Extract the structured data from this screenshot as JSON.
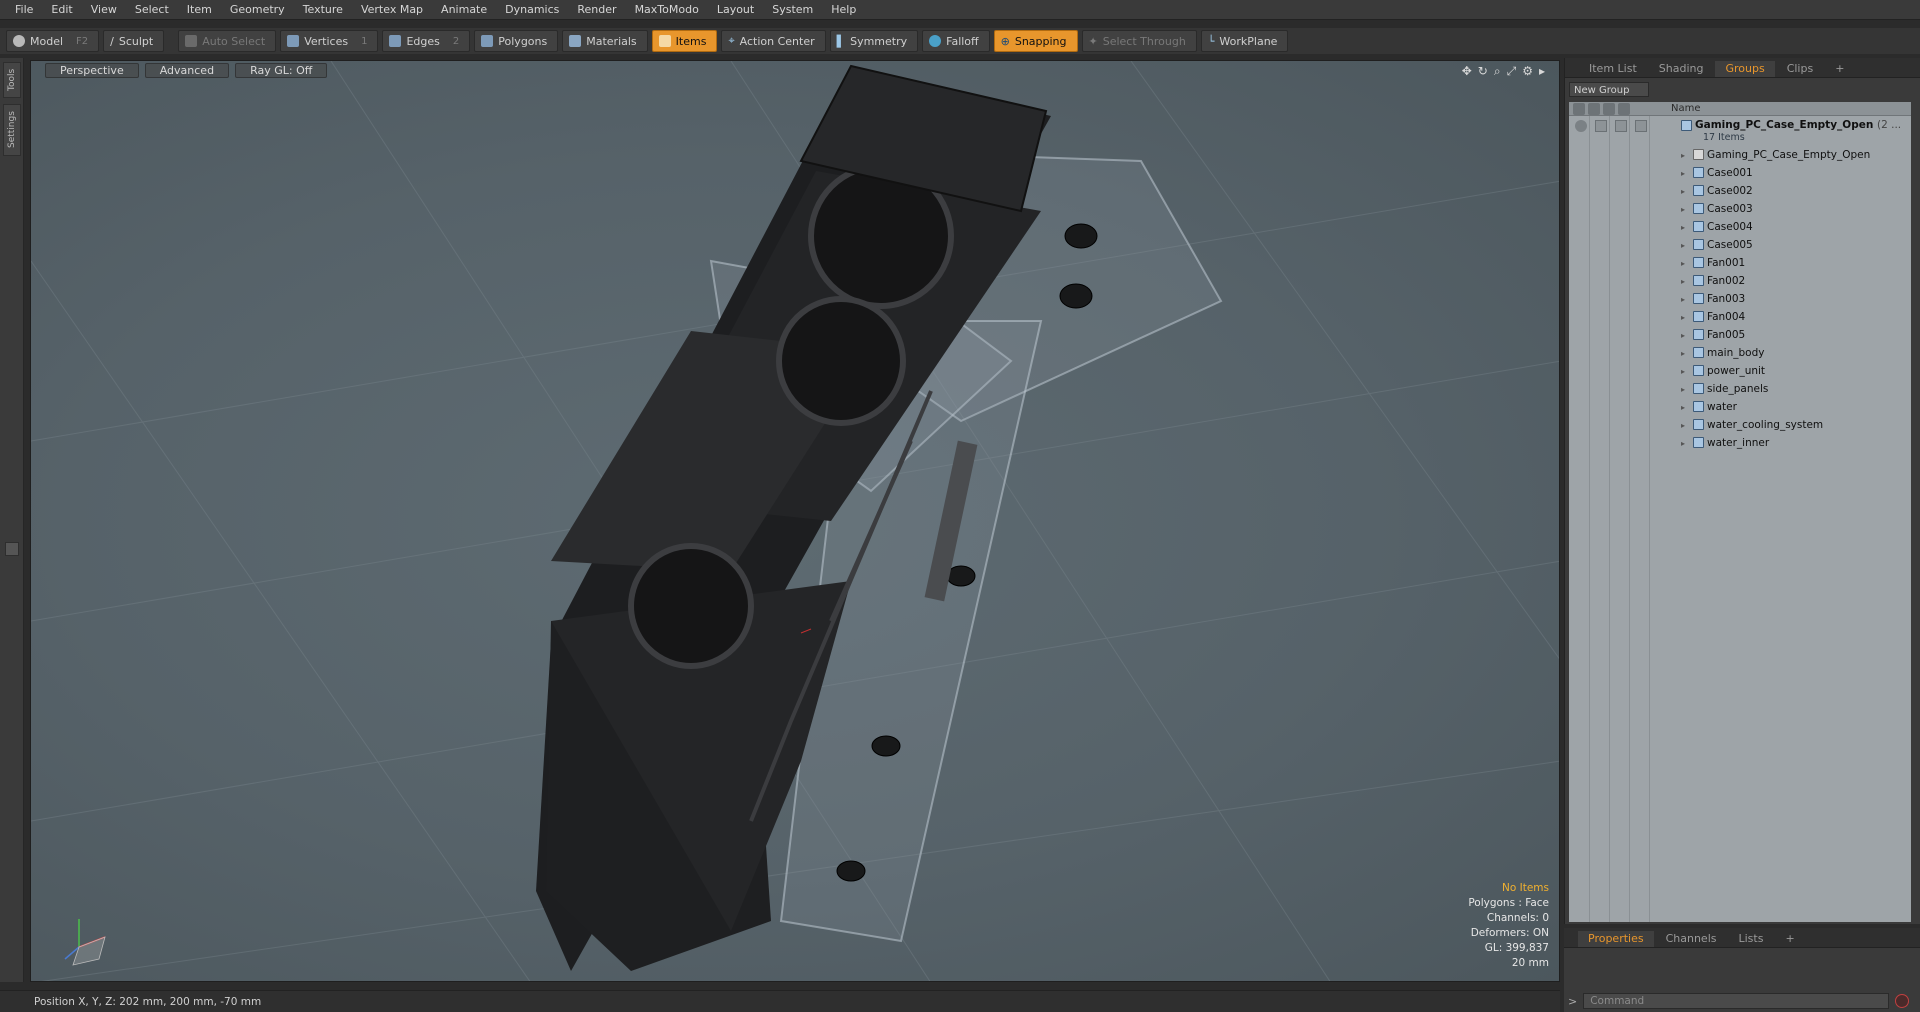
{
  "menubar": {
    "items": [
      "File",
      "Edit",
      "View",
      "Select",
      "Item",
      "Geometry",
      "Texture",
      "Vertex Map",
      "Animate",
      "Dynamics",
      "Render",
      "MaxToModo",
      "Layout",
      "System",
      "Help"
    ]
  },
  "toolbar": {
    "model": "Model",
    "model_key": "F2",
    "sculpt": "Sculpt",
    "auto_select": "Auto Select",
    "vertices": "Vertices",
    "vertices_key": "1",
    "edges": "Edges",
    "edges_key": "2",
    "polygons": "Polygons",
    "materials": "Materials",
    "items": "Items",
    "action_center": "Action Center",
    "symmetry": "Symmetry",
    "falloff": "Falloff",
    "snapping": "Snapping",
    "select_through": "Select Through",
    "workplane": "WorkPlane",
    "accent_color": "#e8962c"
  },
  "leftstrip": {
    "tools": "Tools",
    "settings": "Settings"
  },
  "viewport": {
    "view_mode": "Perspective",
    "shading": "Advanced",
    "raygl": "Ray GL: Off",
    "info": {
      "selection": "No Items",
      "polygons": "Polygons : Face",
      "channels": "Channels: 0",
      "deformers": "Deformers: ON",
      "gl": "GL: 399,837",
      "grid": "20 mm"
    }
  },
  "right_panel": {
    "tabs": [
      "Item List",
      "Shading",
      "Groups",
      "Clips",
      "+"
    ],
    "selected_tab": "Groups",
    "new_group": "New Group",
    "column_name": "Name",
    "root": {
      "name": "Gaming_PC_Case_Empty_Open",
      "suffix": "(2 ...",
      "count": "17 Items"
    },
    "items": [
      "Gaming_PC_Case_Empty_Open",
      "Case001",
      "Case002",
      "Case003",
      "Case004",
      "Case005",
      "Fan001",
      "Fan002",
      "Fan003",
      "Fan004",
      "Fan005",
      "main_body",
      "power_unit",
      "side_panels",
      "water",
      "water_cooling_system",
      "water_inner"
    ]
  },
  "bottom_panel": {
    "tabs": [
      "Properties",
      "Channels",
      "Lists",
      "+"
    ],
    "selected_tab": "Properties"
  },
  "command": {
    "prompt": ">",
    "placeholder": "Command"
  },
  "status": {
    "position": "Position X, Y, Z:   202 mm, 200 mm, -70 mm"
  }
}
